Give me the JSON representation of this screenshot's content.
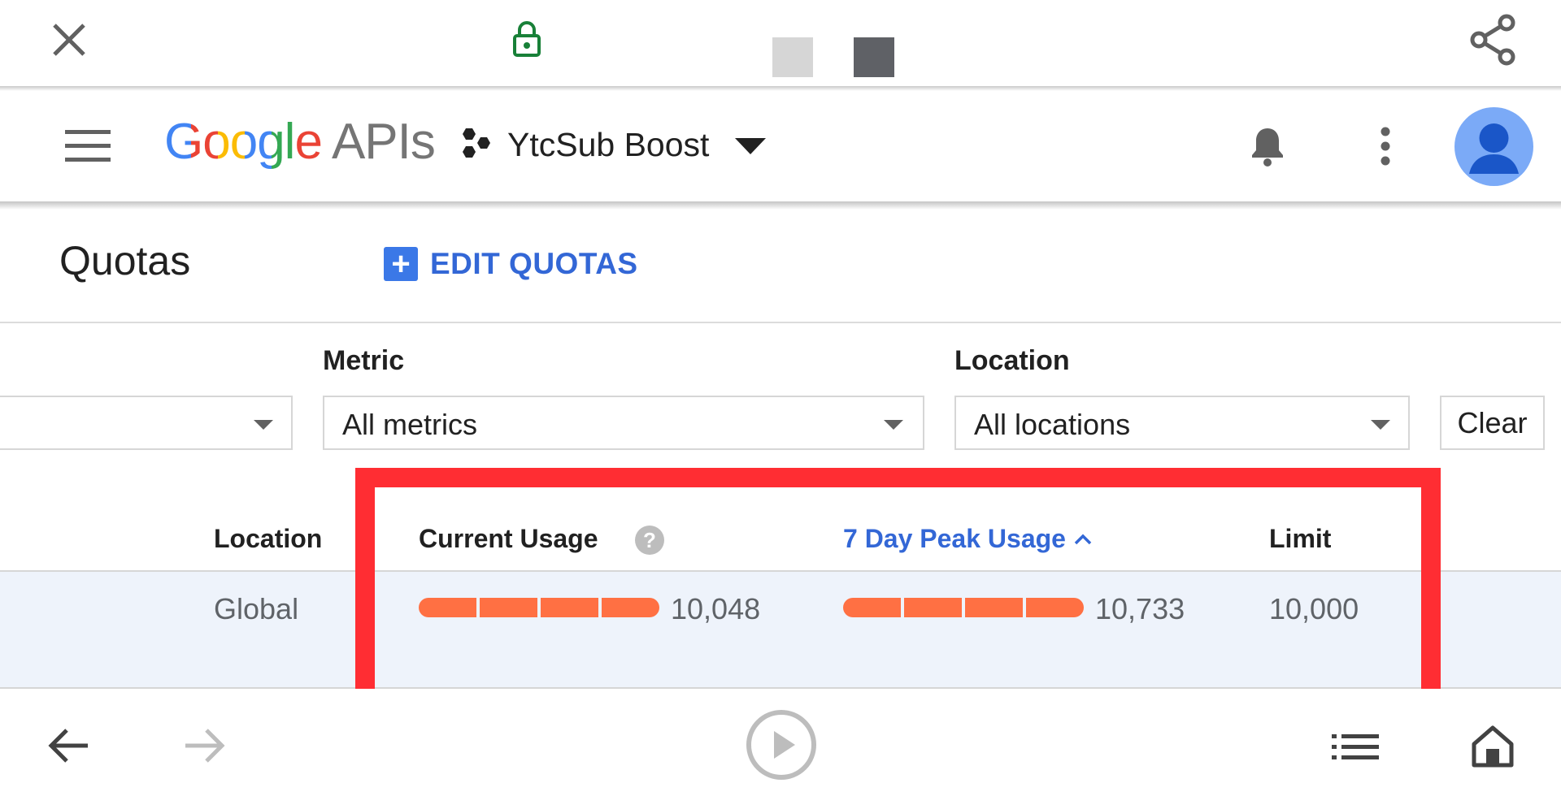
{
  "browser": {
    "close_icon": "close-icon",
    "lock_icon": "lock-icon",
    "share_icon": "share-icon",
    "url_swatches": [
      "#d6d6d6",
      "#5f6166"
    ]
  },
  "header": {
    "logo_google": "Google",
    "logo_apis": "APIs",
    "project_name": "YtcSub Boost",
    "menu_icon": "hamburger-menu-icon",
    "project_icon": "project-hexagons-icon",
    "dropdown_icon": "caret-down-icon",
    "bell_icon": "notifications-bell-icon",
    "more_icon": "more-vert-icon",
    "avatar_icon": "account-avatar-icon"
  },
  "page": {
    "title": "Quotas",
    "edit_quotas_label": "EDIT QUOTAS"
  },
  "filters": {
    "metric_label": "Metric",
    "metric_value": "All metrics",
    "location_label": "Location",
    "location_value": "All locations",
    "clear_label": "Clear"
  },
  "table": {
    "headers": {
      "location": "Location",
      "current_usage": "Current Usage",
      "peak_usage": "7 Day Peak Usage",
      "limit": "Limit"
    },
    "rows": [
      {
        "location": "Global",
        "current_usage": "10,048",
        "peak_usage": "10,733",
        "limit": "10,000",
        "current_usage_fraction": 1.0,
        "peak_usage_fraction": 1.0
      }
    ]
  },
  "colors": {
    "accent_blue": "#3367d6",
    "usage_bar": "#ff7043",
    "highlight_red": "#ff2d33",
    "row_highlight": "#eef3fb"
  },
  "bottom_nav": {
    "back_icon": "arrow-back-icon",
    "forward_icon": "arrow-forward-icon",
    "play_icon": "play-circle-icon",
    "list_icon": "list-icon",
    "home_icon": "home-icon"
  }
}
